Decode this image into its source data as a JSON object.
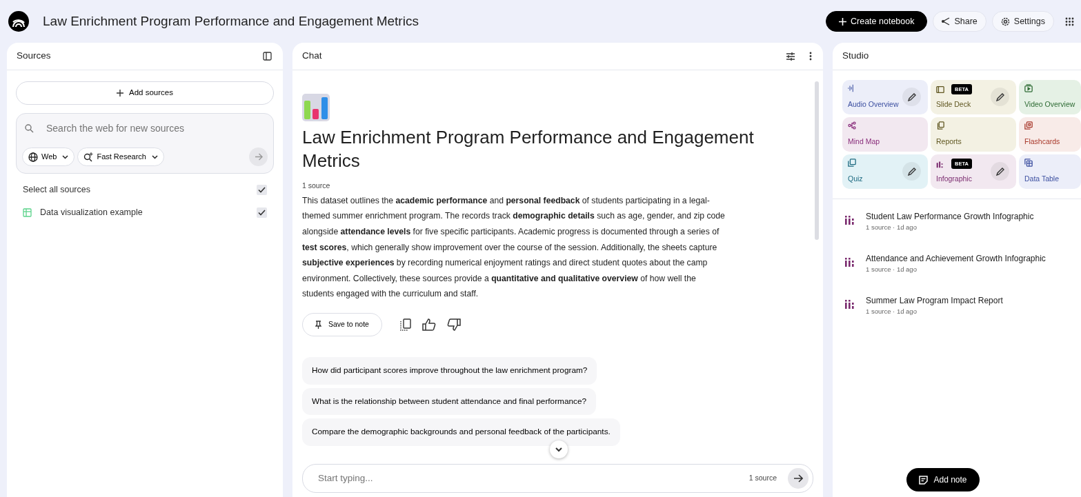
{
  "app": {
    "title": "Law Enrichment Program Performance and Engagement Metrics"
  },
  "header_buttons": [
    {
      "kind": "create",
      "label": "Create notebook"
    },
    {
      "kind": "share",
      "label": "Share"
    },
    {
      "kind": "settings",
      "label": "Settings"
    }
  ],
  "sources": {
    "title": "Sources",
    "add_button": "Add sources",
    "search": {
      "placeholder": "Search the web for new sources"
    },
    "filters": [
      {
        "kind": "web",
        "label": "Web"
      },
      {
        "kind": "research",
        "label": "Fast Research"
      }
    ],
    "select_all": {
      "label": "Select all sources",
      "checked": true
    },
    "items": [
      {
        "name": "Data visualization example",
        "checked": true
      }
    ]
  },
  "chat": {
    "title": "Chat",
    "heading": "Law Enrichment Program Performance and Engagement Metrics",
    "source_count": "1 source",
    "summary": "This dataset outlines the **academic performance** and **personal feedback** of students participating in a legal-themed summer enrichment program. The records track **demographic details** such as age, gender, and zip code alongside **attendance levels** for five specific participants. Academic progress is documented through a series of **test scores**, which generally show improvement over the course of the session. Additionally, the sheets capture **subjective experiences** by recording numerical enjoyment ratings and direct student quotes about the camp environment. Collectively, these sources provide a **quantitative and qualitative overview** of how well the students engaged with the curriculum and staff.",
    "save_button": "Save to note",
    "suggestions": [
      "How did participant scores improve throughout the law enrichment program?",
      "What is the relationship between student attendance and final performance?",
      "Compare the demographic backgrounds and personal feedback of the participants."
    ],
    "input": {
      "placeholder": "Start typing...",
      "source_count": "1 source"
    }
  },
  "studio": {
    "title": "Studio",
    "tools": [
      {
        "kind": "audio",
        "label": "Audio Overview",
        "editable": true,
        "color": "#eceef9"
      },
      {
        "kind": "slides",
        "label": "Slide Deck",
        "badge": "BETA",
        "editable": true,
        "color": "#f3f1e3"
      },
      {
        "kind": "video",
        "label": "Video Overview",
        "editable": false,
        "color": "#e5f1e5"
      },
      {
        "kind": "mindmap",
        "label": "Mind Map",
        "editable": false,
        "color": "#f2e8f0"
      },
      {
        "kind": "reports",
        "label": "Reports",
        "editable": false,
        "color": "#f3f1e3"
      },
      {
        "kind": "flashcards",
        "label": "Flashcards",
        "editable": false,
        "color": "#f8ebe8"
      },
      {
        "kind": "quiz",
        "label": "Quiz",
        "editable": true,
        "color": "#e2f2f6"
      },
      {
        "kind": "infographic",
        "label": "Infographic",
        "badge": "BETA",
        "editable": true,
        "color": "#f2e8f0"
      },
      {
        "kind": "table",
        "label": "Data Table",
        "editable": false,
        "color": "#eceef9"
      }
    ],
    "notes": [
      {
        "title": "Student Law Performance Growth Infographic",
        "meta": "1 source · 1d ago"
      },
      {
        "title": "Attendance and Achievement Growth Infographic",
        "meta": "1 source · 1d ago"
      },
      {
        "title": "Summer Law Program Impact Report",
        "meta": "1 source · 1d ago"
      }
    ],
    "add_note": "Add note"
  }
}
